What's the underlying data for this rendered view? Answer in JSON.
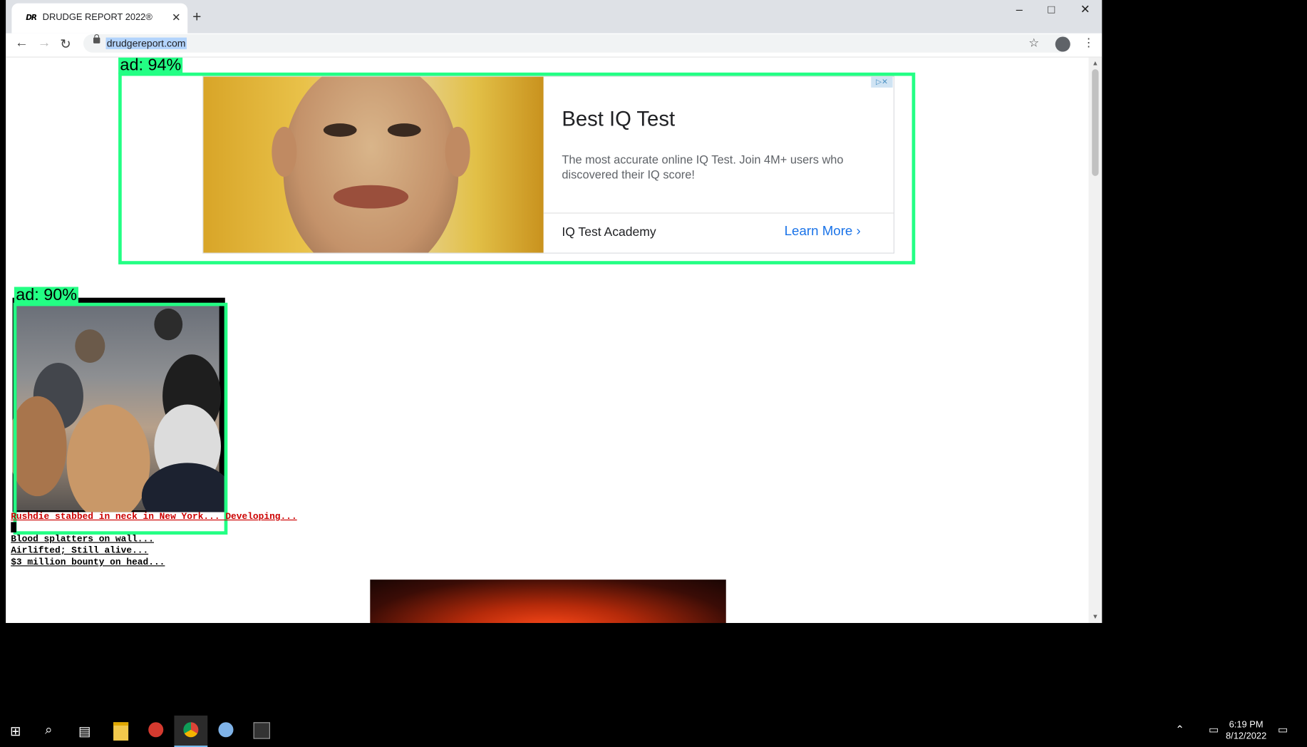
{
  "browser": {
    "tab_icon": "DR",
    "tab_title": "DRUDGE REPORT 2022®",
    "tab_close": "✕",
    "new_tab": "+",
    "url": "drudgereport.com"
  },
  "ads": {
    "top": {
      "title": "Best IQ Test",
      "description": "The most accurate online IQ Test. Join 4M+ users who discovered their IQ score!",
      "advertiser": "IQ Test Academy",
      "cta": "Learn More",
      "adchoices_icon": "adchoices-icon"
    }
  },
  "detections": {
    "top_label": "ad: 94%",
    "photo_label": "ad: 90%"
  },
  "headlines": [
    "Rushdie stabbed in neck in New York... Developing...",
    "Blood splatters on wall...",
    "Airlifted; Still alive...",
    "$3 million bounty on head..."
  ],
  "taskbar": {
    "time": "6:19 PM",
    "date": "8/12/2022",
    "apps": [
      "file-explorer-icon",
      "spider-app-icon",
      "chrome-icon",
      "paint-icon",
      "terminal-icon"
    ]
  },
  "colors": {
    "detection_box": "#23ff84",
    "headline_red": "#cc0000",
    "ad_cta": "#1a73e8"
  }
}
